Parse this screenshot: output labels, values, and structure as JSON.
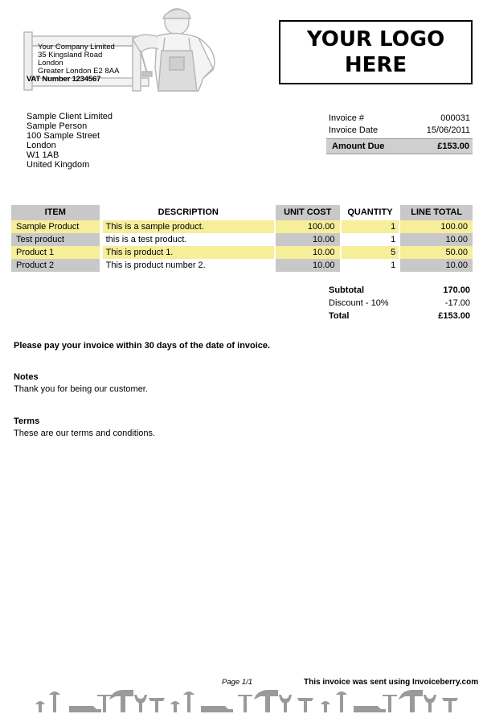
{
  "company": {
    "name": "Your Company Limited",
    "address_line1": "35 Kingsland Road",
    "address_line2": "London",
    "address_line3": "Greater London E2 8AA",
    "vat": "VAT Number 1234567",
    "illustration": "handyman-leaning-on-sign-illustration"
  },
  "logo": {
    "line1": "YOUR LOGO",
    "line2": "HERE"
  },
  "client": {
    "lines": [
      "Sample Client Limited",
      "Sample Person",
      "100 Sample Street",
      "London",
      "W1 1AB",
      "United Kingdom"
    ]
  },
  "invoice_meta": {
    "number_label": "Invoice #",
    "number_value": "000031",
    "date_label": "Invoice Date",
    "date_value": "15/06/2011",
    "amount_due_label": "Amount Due",
    "amount_due_value": "£153.00"
  },
  "items_table": {
    "headers": [
      "ITEM",
      "DESCRIPTION",
      "UNIT COST",
      "QUANTITY",
      "LINE TOTAL"
    ],
    "rows": [
      {
        "item": "Sample Product",
        "description": "This is a sample product.",
        "unit_cost": "100.00",
        "quantity": "1",
        "line_total": "100.00"
      },
      {
        "item": "Test product",
        "description": "this is a test product.",
        "unit_cost": "10.00",
        "quantity": "1",
        "line_total": "10.00"
      },
      {
        "item": "Product 1",
        "description": "This is product 1.",
        "unit_cost": "10.00",
        "quantity": "5",
        "line_total": "50.00"
      },
      {
        "item": "Product 2",
        "description": "This is product number 2.",
        "unit_cost": "10.00",
        "quantity": "1",
        "line_total": "10.00"
      }
    ],
    "colors": {
      "header_gray": "#c8c8c8",
      "highlight_yellow": "#f7ee9a"
    }
  },
  "totals": {
    "subtotal_label": "Subtotal",
    "subtotal_value": "170.00",
    "discount_label": "Discount - 10%",
    "discount_value": "-17.00",
    "total_label": "Total",
    "total_value": "£153.00"
  },
  "payment_terms": "Please pay your invoice within 30 days of the date of invoice.",
  "notes": {
    "heading": "Notes",
    "text": "Thank you for being our customer."
  },
  "terms": {
    "heading": "Terms",
    "text": "These are our terms and conditions."
  },
  "footer": {
    "page": "Page 1/1",
    "sent_using": "This invoice was sent using Invoiceberry.com",
    "decoration": "tools-border-icons"
  }
}
